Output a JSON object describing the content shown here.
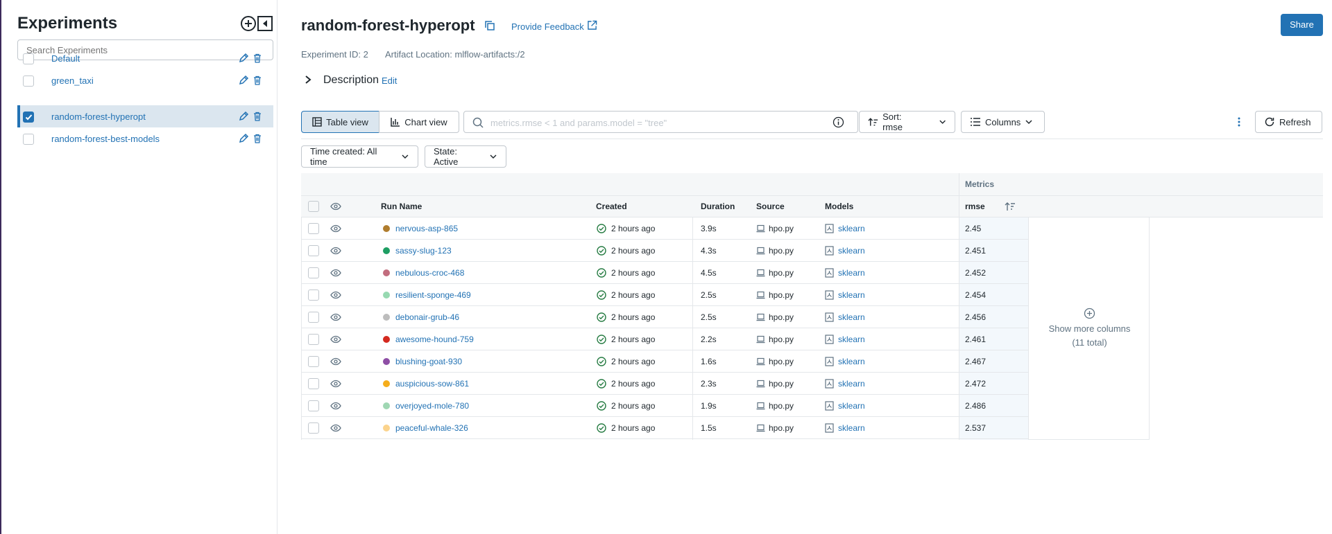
{
  "sidebar": {
    "title": "Experiments",
    "search_placeholder": "Search Experiments",
    "items": [
      {
        "name": "Default",
        "checked": false
      },
      {
        "name": "green_taxi",
        "checked": false
      },
      {
        "name": "random-forest-hyperopt",
        "checked": true
      },
      {
        "name": "random-forest-best-models",
        "checked": false
      }
    ]
  },
  "header": {
    "title": "random-forest-hyperopt",
    "feedback_label": "Provide Feedback",
    "share_label": "Share",
    "experiment_id": "Experiment ID: 2",
    "artifact_location": "Artifact Location: mlflow-artifacts:/2",
    "description_label": "Description",
    "description_edit": "Edit"
  },
  "toolbar": {
    "table_view": "Table view",
    "chart_view": "Chart view",
    "search_placeholder": "metrics.rmse < 1 and params.model = \"tree\"",
    "sort_label": "Sort: rmse",
    "columns_label": "Columns",
    "refresh_label": "Refresh",
    "time_filter": "Time created: All time",
    "state_filter": "State: Active"
  },
  "table": {
    "group_header": "Metrics",
    "headers": {
      "run_name": "Run Name",
      "created": "Created",
      "duration": "Duration",
      "source": "Source",
      "models": "Models",
      "rmse": "rmse"
    },
    "rows": [
      {
        "run_name": "nervous-asp-865",
        "color": "#b07d2e",
        "created": "2 hours ago",
        "duration": "3.9s",
        "source": "hpo.py",
        "model": "sklearn",
        "rmse": "2.45"
      },
      {
        "run_name": "sassy-slug-123",
        "color": "#1e9e63",
        "created": "2 hours ago",
        "duration": "4.3s",
        "source": "hpo.py",
        "model": "sklearn",
        "rmse": "2.451"
      },
      {
        "run_name": "nebulous-croc-468",
        "color": "#c26d7e",
        "created": "2 hours ago",
        "duration": "4.5s",
        "source": "hpo.py",
        "model": "sklearn",
        "rmse": "2.452"
      },
      {
        "run_name": "resilient-sponge-469",
        "color": "#97d9b1",
        "created": "2 hours ago",
        "duration": "2.5s",
        "source": "hpo.py",
        "model": "sklearn",
        "rmse": "2.454"
      },
      {
        "run_name": "debonair-grub-46",
        "color": "#bdbdbd",
        "created": "2 hours ago",
        "duration": "2.5s",
        "source": "hpo.py",
        "model": "sklearn",
        "rmse": "2.456"
      },
      {
        "run_name": "awesome-hound-759",
        "color": "#d4291f",
        "created": "2 hours ago",
        "duration": "2.2s",
        "source": "hpo.py",
        "model": "sklearn",
        "rmse": "2.461"
      },
      {
        "run_name": "blushing-goat-930",
        "color": "#8e4ea5",
        "created": "2 hours ago",
        "duration": "1.6s",
        "source": "hpo.py",
        "model": "sklearn",
        "rmse": "2.467"
      },
      {
        "run_name": "auspicious-sow-861",
        "color": "#f5ad1b",
        "created": "2 hours ago",
        "duration": "2.3s",
        "source": "hpo.py",
        "model": "sklearn",
        "rmse": "2.472"
      },
      {
        "run_name": "overjoyed-mole-780",
        "color": "#9fd7b3",
        "created": "2 hours ago",
        "duration": "1.9s",
        "source": "hpo.py",
        "model": "sklearn",
        "rmse": "2.486"
      },
      {
        "run_name": "peaceful-whale-326",
        "color": "#fbd38c",
        "created": "2 hours ago",
        "duration": "1.5s",
        "source": "hpo.py",
        "model": "sklearn",
        "rmse": "2.537"
      }
    ],
    "show_more_label": "Show more columns",
    "show_more_count": "(11 total)"
  },
  "colors": {
    "accent": "#2272b4",
    "success": "#277c43"
  }
}
